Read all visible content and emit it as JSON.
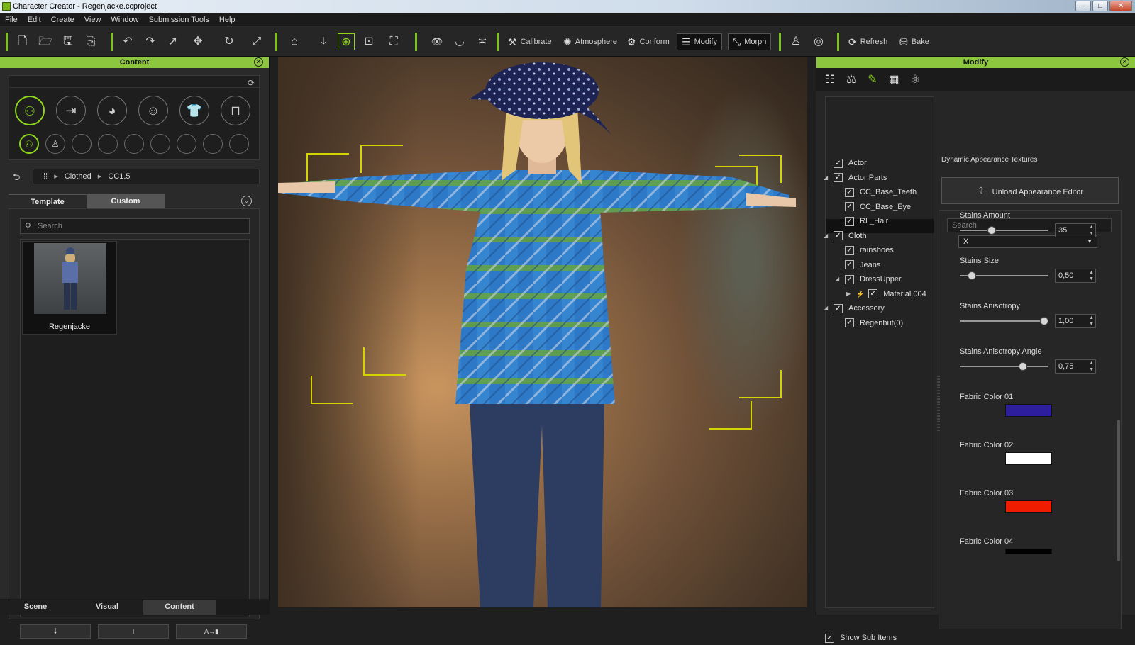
{
  "window": {
    "title": "Character Creator - Regenjacke.ccproject",
    "minimize": "–",
    "maximize": "□",
    "close": "✕"
  },
  "menu": [
    "File",
    "Edit",
    "Create",
    "View",
    "Window",
    "Submission Tools",
    "Help"
  ],
  "toolbar": {
    "calibrate": "Calibrate",
    "atmosphere": "Atmosphere",
    "conform": "Conform",
    "modify": "Modify",
    "morph": "Morph",
    "refresh": "Refresh",
    "bake": "Bake"
  },
  "content_panel": {
    "title": "Content",
    "breadcrumb": [
      "Clothed",
      "CC1.5"
    ],
    "tabs": {
      "template": "Template",
      "custom": "Custom"
    },
    "search_placeholder": "Search",
    "item": {
      "label": "Regenjacke"
    }
  },
  "bottom_tabs": [
    "Scene",
    "Visual",
    "Content"
  ],
  "modify_panel": {
    "title": "Modify",
    "tree": [
      {
        "label": "Actor",
        "level": 0,
        "arrow": ""
      },
      {
        "label": "Actor Parts",
        "level": 0,
        "arrow": "◢"
      },
      {
        "label": "CC_Base_Teeth",
        "level": 1,
        "arrow": ""
      },
      {
        "label": "CC_Base_Eye",
        "level": 1,
        "arrow": ""
      },
      {
        "label": "RL_Hair",
        "level": 1,
        "arrow": ""
      },
      {
        "label": "Cloth",
        "level": 0,
        "arrow": "◢"
      },
      {
        "label": "rainshoes",
        "level": 1,
        "arrow": ""
      },
      {
        "label": "Jeans",
        "level": 1,
        "arrow": ""
      },
      {
        "label": "DressUpper",
        "level": 1,
        "arrow": "◢",
        "selected": true
      },
      {
        "label": "Material.004",
        "level": 2,
        "arrow": "▶"
      },
      {
        "label": "Accessory",
        "level": 0,
        "arrow": "◢"
      },
      {
        "label": "Regenhut(0)",
        "level": 1,
        "arrow": ""
      }
    ],
    "section_title": "Dynamic Appearance Textures",
    "unload_button": "Unload Appearance Editor",
    "search_placeholder": "Search",
    "dropdown_value": "X",
    "sliders": [
      {
        "label": "Stains Amount",
        "value": "35",
        "fraction": 0.36
      },
      {
        "label": "Stains Size",
        "value": "0,50",
        "fraction": 0.14
      },
      {
        "label": "Stains Anisotropy",
        "value": "1,00",
        "fraction": 0.96
      },
      {
        "label": "Stains Anisotropy Angle",
        "value": "0,75",
        "fraction": 0.72
      }
    ],
    "colors": [
      {
        "label": "Fabric Color 01",
        "color": "#2c1e9c"
      },
      {
        "label": "Fabric Color 02",
        "color": "#ffffff"
      },
      {
        "label": "Fabric Color 03",
        "color": "#f01c00"
      },
      {
        "label": "Fabric Color 04",
        "color": "#000000"
      }
    ],
    "show_sub_items": "Show Sub Items"
  },
  "accent_color": "#8cc63f"
}
